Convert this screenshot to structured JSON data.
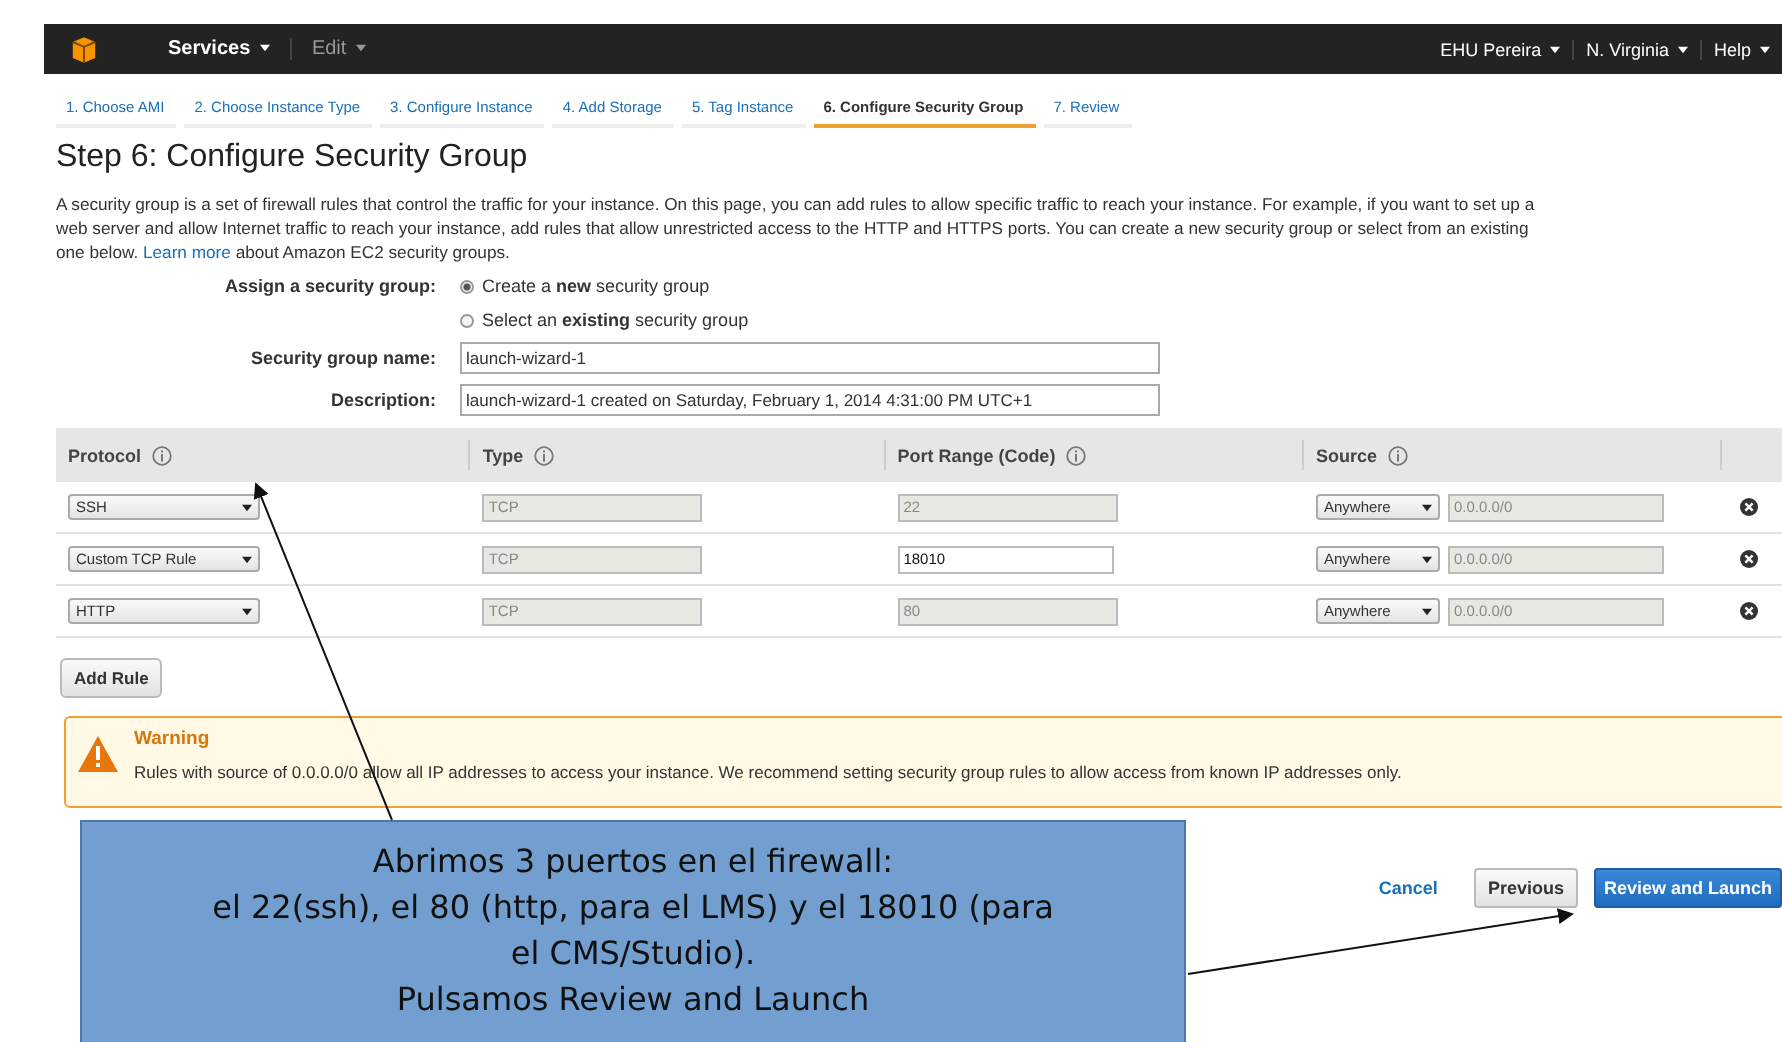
{
  "top_bar": {
    "menus": [
      {
        "label": "Services",
        "disabled": false
      },
      {
        "label": "Edit",
        "disabled": true
      }
    ],
    "right_menus": [
      "EHU Pereira",
      "N. Virginia",
      "Help"
    ]
  },
  "steps": [
    {
      "label": "1. Choose AMI",
      "selected": false
    },
    {
      "label": "2. Choose Instance Type",
      "selected": false
    },
    {
      "label": "3. Configure Instance",
      "selected": false
    },
    {
      "label": "4. Add Storage",
      "selected": false
    },
    {
      "label": "5. Tag Instance",
      "selected": false
    },
    {
      "label": "6. Configure Security Group",
      "selected": true
    },
    {
      "label": "7. Review",
      "selected": false
    }
  ],
  "heading": "Step 6: Configure Security Group",
  "intro": {
    "lines": [
      "A security group is a set of firewall rules that control the traffic for your instance. On this page, you can add rules to allow specific traffic to reach your instance. For example, if you want to set up a",
      "web server and allow Internet traffic to reach your instance, add rules that allow unrestricted access to the HTTP and HTTPS ports. You can create a new security group or select from an existing",
      "one below."
    ],
    "link": "Learn more",
    "after": "about Amazon EC2 security groups."
  },
  "assign": {
    "label": "Assign a security group:",
    "options": [
      {
        "text": "Create a **new** security group",
        "selected": true
      },
      {
        "text": "Select an **existing** security group",
        "selected": false
      }
    ]
  },
  "fields": [
    {
      "label": "Security group name:",
      "value": "launch-wizard-1"
    },
    {
      "label": "Description:",
      "value": "launch-wizard-1 created on Saturday, February 1, 2014 4:31:00 PM UTC+1"
    }
  ],
  "table": {
    "columns": [
      "Protocol",
      "Type",
      "Port Range (Code)",
      "Source"
    ],
    "rows": [
      {
        "protocol": "SSH",
        "type": "TCP",
        "port": "22",
        "port_disabled": true,
        "source": "Anywhere",
        "cidr": "0.0.0.0/0"
      },
      {
        "protocol": "Custom TCP Rule",
        "type": "TCP",
        "port": "18010",
        "port_disabled": false,
        "source": "Anywhere",
        "cidr": "0.0.0.0/0"
      },
      {
        "protocol": "HTTP",
        "type": "TCP",
        "port": "80",
        "port_disabled": true,
        "source": "Anywhere",
        "cidr": "0.0.0.0/0"
      }
    ]
  },
  "add_rule": "Add Rule",
  "warning": {
    "title": "Warning",
    "text": "Rules with source of 0.0.0.0/0 allow all IP addresses to access your instance. We recommend setting security group rules to allow access from known IP addresses only."
  },
  "footer": {
    "cancel": "Cancel",
    "previous": "Previous",
    "primary": "Review and Launch"
  },
  "callout": {
    "lines": [
      "Abrimos 3 puertos en el firewall:",
      "el 22(ssh), el 80 (http, para el LMS) y el 18010 (para",
      "el CMS/Studio).",
      "Pulsamos Review and Launch"
    ]
  }
}
